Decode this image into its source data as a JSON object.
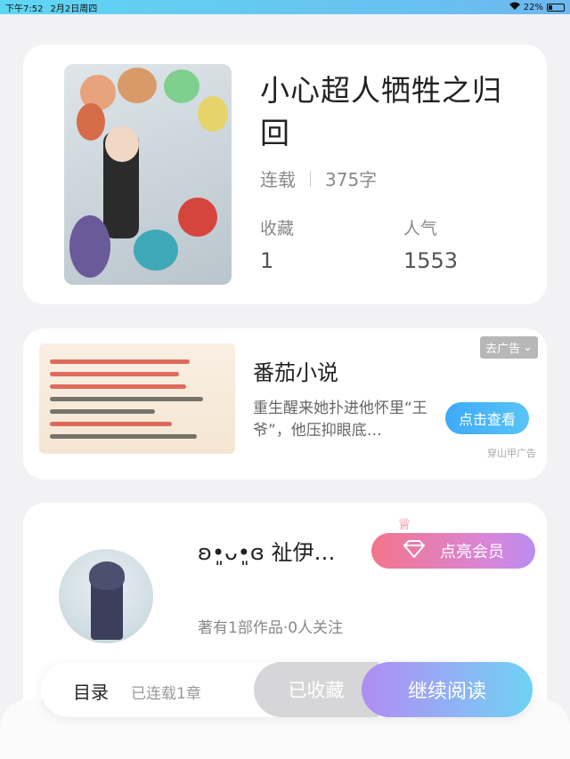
{
  "status_bar": {
    "time": "下午7:52",
    "date": "2月2日周四",
    "battery": "22%"
  },
  "book": {
    "title": "小心超人牺牲之归回",
    "status": "连载",
    "word_count": "375字",
    "favorites_label": "收藏",
    "favorites_value": "1",
    "popularity_label": "人气",
    "popularity_value": "1553"
  },
  "ad": {
    "title": "番茄小说",
    "description": "重生醒来她扑进他怀里“王爷”，他压抑眼底…",
    "close_label": "去广告",
    "cta_label": "点击查看",
    "source": "穿山甲广告"
  },
  "author": {
    "name": "ʚ•͈ᴗ•͈ɞ 祉伊…",
    "vip_label": "点亮会员",
    "info": "著有1部作品·0人关注"
  },
  "bottom_bar": {
    "toc_label": "目录",
    "toc_count": "已连载1章",
    "favorited_label": "已收藏",
    "continue_label": "继续阅读"
  }
}
